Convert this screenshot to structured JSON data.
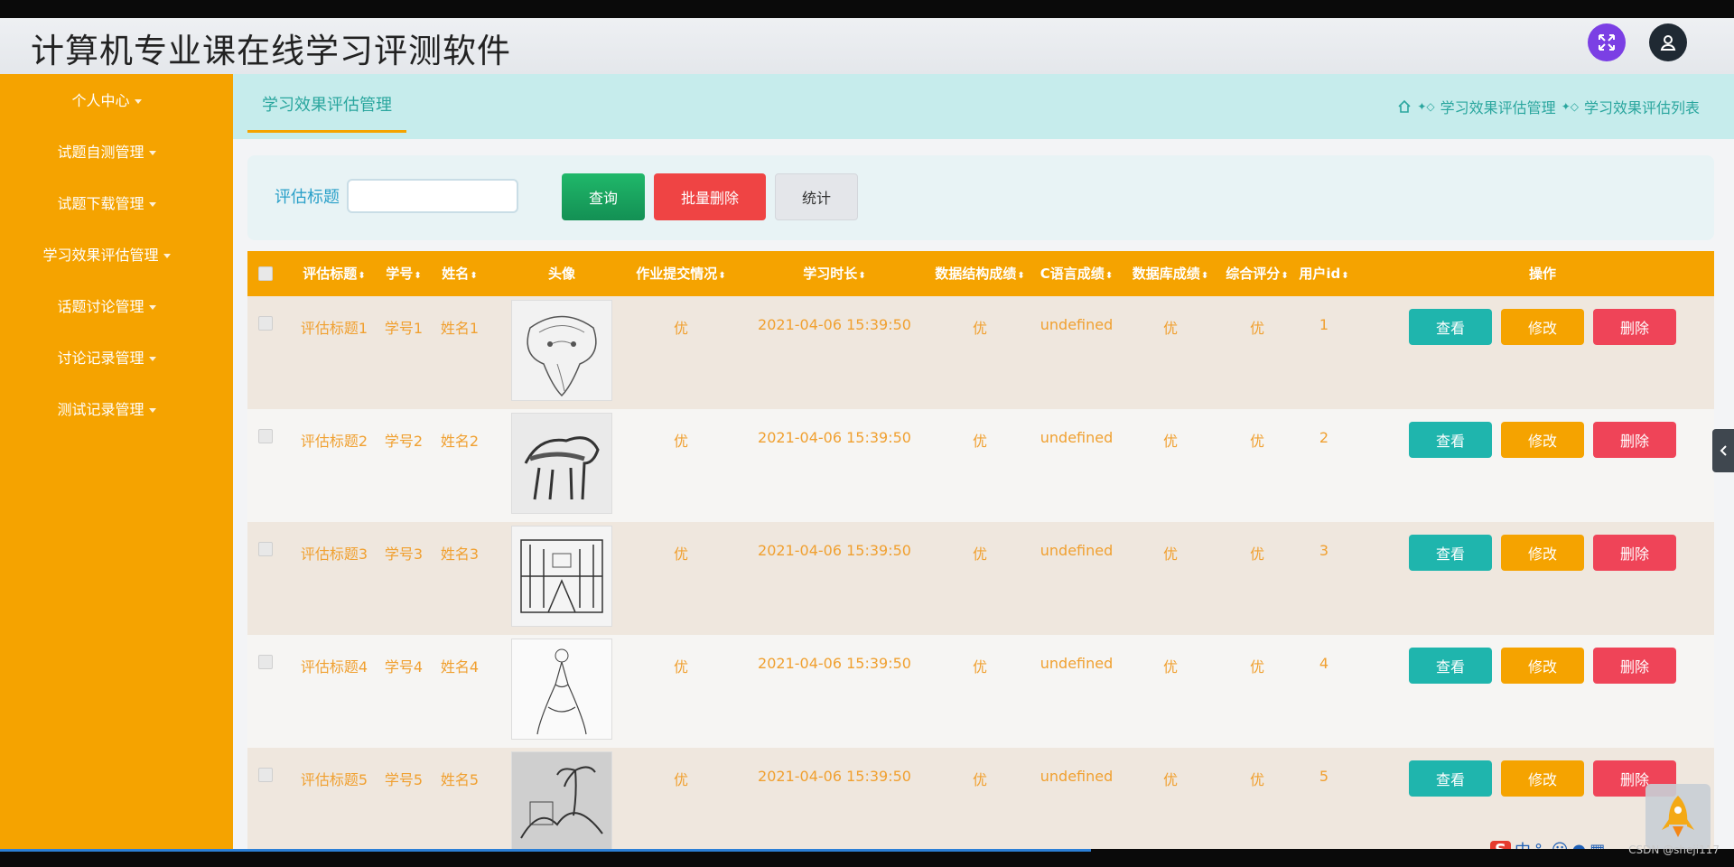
{
  "header": {
    "title": "计算机专业课在线学习评测软件",
    "fullscreen_icon": "fullscreen-icon",
    "user_icon": "user-icon"
  },
  "sidebar": {
    "items": [
      {
        "label": "个人中心"
      },
      {
        "label": "试题自测管理"
      },
      {
        "label": "试题下载管理"
      },
      {
        "label": "学习效果评估管理"
      },
      {
        "label": "话题讨论管理"
      },
      {
        "label": "讨论记录管理"
      },
      {
        "label": "测试记录管理"
      }
    ]
  },
  "breadcrumb": {
    "tab": "学习效果评估管理",
    "path": [
      "学习效果评估管理",
      "学习效果评估列表"
    ]
  },
  "search": {
    "label": "评估标题",
    "value": "",
    "buttons": {
      "query": "查询",
      "batch_delete": "批量删除",
      "stats": "统计"
    }
  },
  "table": {
    "headers": [
      "评估标题",
      "学号",
      "姓名",
      "头像",
      "作业提交情况",
      "学习时长",
      "数据结构成绩",
      "C语言成绩",
      "数据库成绩",
      "综合评分",
      "用户id",
      "操作"
    ],
    "actions": {
      "view": "查看",
      "edit": "修改",
      "delete": "删除"
    },
    "rows": [
      {
        "title": "评估标题1",
        "student_no": "学号1",
        "name": "姓名1",
        "avatar": "elephant-sketch",
        "homework": "优",
        "duration": "2021-04-06 15:39:50",
        "ds": "优",
        "c": "undefined",
        "db": "优",
        "overall": "优",
        "uid": "1"
      },
      {
        "title": "评估标题2",
        "student_no": "学号2",
        "name": "姓名2",
        "avatar": "horse-sketch",
        "homework": "优",
        "duration": "2021-04-06 15:39:50",
        "ds": "优",
        "c": "undefined",
        "db": "优",
        "overall": "优",
        "uid": "2"
      },
      {
        "title": "评估标题3",
        "student_no": "学号3",
        "name": "姓名3",
        "avatar": "street-sketch",
        "homework": "优",
        "duration": "2021-04-06 15:39:50",
        "ds": "优",
        "c": "undefined",
        "db": "优",
        "overall": "优",
        "uid": "3"
      },
      {
        "title": "评估标题4",
        "student_no": "学号4",
        "name": "姓名4",
        "avatar": "dancer-sketch",
        "homework": "优",
        "duration": "2021-04-06 15:39:50",
        "ds": "优",
        "c": "undefined",
        "db": "优",
        "overall": "优",
        "uid": "4"
      },
      {
        "title": "评估标题5",
        "student_no": "学号5",
        "name": "姓名5",
        "avatar": "garden-sketch",
        "homework": "优",
        "duration": "2021-04-06 15:39:50",
        "ds": "优",
        "c": "undefined",
        "db": "优",
        "overall": "优",
        "uid": "5"
      }
    ]
  },
  "overlay": {
    "ime_label": "中",
    "watermark": "CSDN @sheji117"
  },
  "colors": {
    "sidebar": "#f5a300",
    "accent": "#1fb5ad",
    "danger": "#ef4458",
    "text_cell": "#f0a030"
  }
}
